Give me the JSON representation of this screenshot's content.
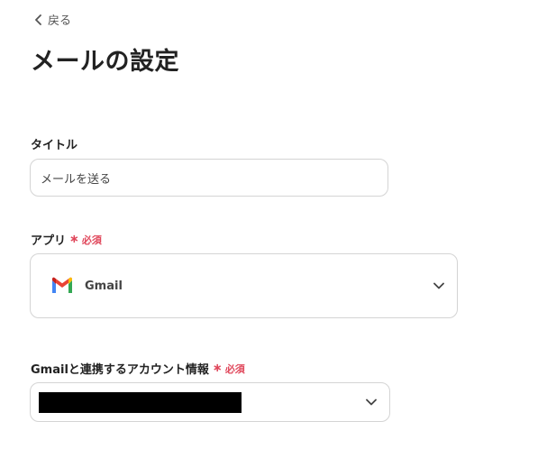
{
  "nav": {
    "back_label": "戻る"
  },
  "page": {
    "title": "メールの設定"
  },
  "form": {
    "title_field": {
      "label": "タイトル",
      "value": "メールを送る"
    },
    "app_field": {
      "label": "アプリ",
      "required_label": "必須",
      "selected_app": "Gmail",
      "app_icon": "gmail-icon"
    },
    "account_field": {
      "label": "Gmailと連携するアカウント情報",
      "required_label": "必須",
      "value_redacted": true
    }
  },
  "colors": {
    "required": "#e0475b",
    "border": "#d4d4d4",
    "gmail_red": "#EA4335",
    "gmail_blue": "#4285F4",
    "gmail_green": "#34A853",
    "gmail_yellow": "#FBBC04"
  }
}
